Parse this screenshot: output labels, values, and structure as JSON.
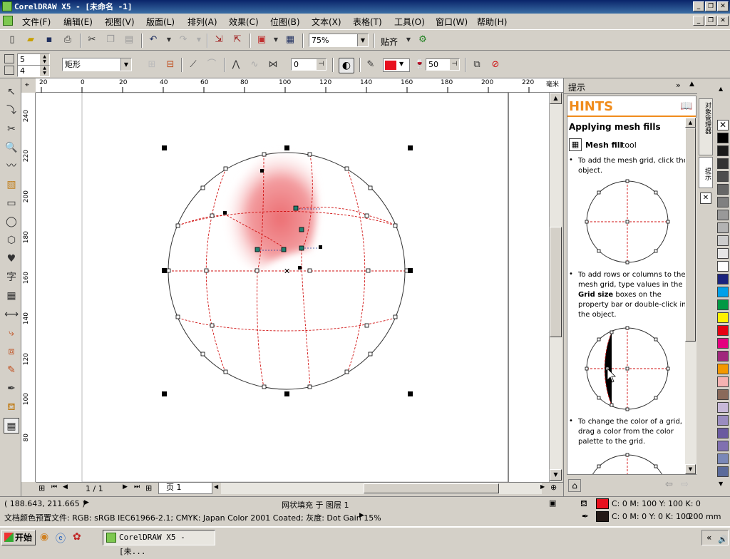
{
  "window": {
    "title": "CorelDRAW X5 - [未命名 -1]"
  },
  "menu": [
    "文件(F)",
    "编辑(E)",
    "视图(V)",
    "版面(L)",
    "排列(A)",
    "效果(C)",
    "位图(B)",
    "文本(X)",
    "表格(T)",
    "工具(O)",
    "窗口(W)",
    "帮助(H)"
  ],
  "toolbar1": {
    "zoom": "75%",
    "snap_label": "贴齐"
  },
  "toolbar2": {
    "grid_cols": "5",
    "grid_rows": "4",
    "selection_mode": "矩形",
    "smoothness": "0",
    "transparency": "50",
    "fill_color": "#e8101e"
  },
  "ruler_top": [
    "20",
    "0",
    "20",
    "40",
    "60",
    "80",
    "100",
    "120",
    "140",
    "160",
    "180",
    "200",
    "220",
    "毫米"
  ],
  "ruler_left": [
    "240",
    "220",
    "200",
    "180",
    "160",
    "140",
    "120",
    "100",
    "80"
  ],
  "page_nav": {
    "counter": "1 / 1",
    "page_tab": "页 1"
  },
  "docker": {
    "header": "提示",
    "hints_title": "HINTS",
    "heading": "Applying mesh fills",
    "tool_name": "Mesh fill",
    "tool_suffix": "tool",
    "bullet1": "To add the mesh grid, click the object.",
    "bullet2_a": "To add rows or columns to the mesh grid, type values in the ",
    "bullet2_bold": "Grid size",
    "bullet2_b": " boxes on the property bar or double-click in the object.",
    "bullet3": "To change the color of a grid, drag a color from the color palette to the grid."
  },
  "dock_tabs": {
    "tab1": "对象管理器",
    "tab2": "提示"
  },
  "palette": [
    "#ffffff",
    "#000000",
    "#1a1a1a",
    "#333333",
    "#4d4d4d",
    "#666666",
    "#808080",
    "#999999",
    "#b3b3b3",
    "#cccccc",
    "#e6e6e6",
    "#ffffff",
    "#1a237e",
    "#00a0e9",
    "#009944",
    "#fff100",
    "#e60012",
    "#e4007f",
    "#a0287d",
    "#f39800",
    "#f5b2b2",
    "#8a6a5a",
    "#c7b8d8",
    "#9a8cc0",
    "#6a5aa0",
    "#8070b0",
    "#7a88b8",
    "#5a6a9a"
  ],
  "status": {
    "coords": "( 188.643, 211.665 )",
    "object_info": "网状填充 于 图层 1",
    "fill_info": "C: 0 M: 100 Y: 100 K: 0",
    "outline_info": "C: 0 M: 0 Y: 0 K: 100",
    "outline_width": ".200 mm",
    "doc_profile": "文档颜色预置文件: RGB: sRGB IEC61966-2.1; CMYK: Japan Color 2001 Coated; 灰度: Dot Gain 15%",
    "fill_color": "#e8101e",
    "outline_color": "#231815"
  },
  "taskbar": {
    "start": "开始",
    "task": "CorelDRAW X5 - [未..."
  }
}
